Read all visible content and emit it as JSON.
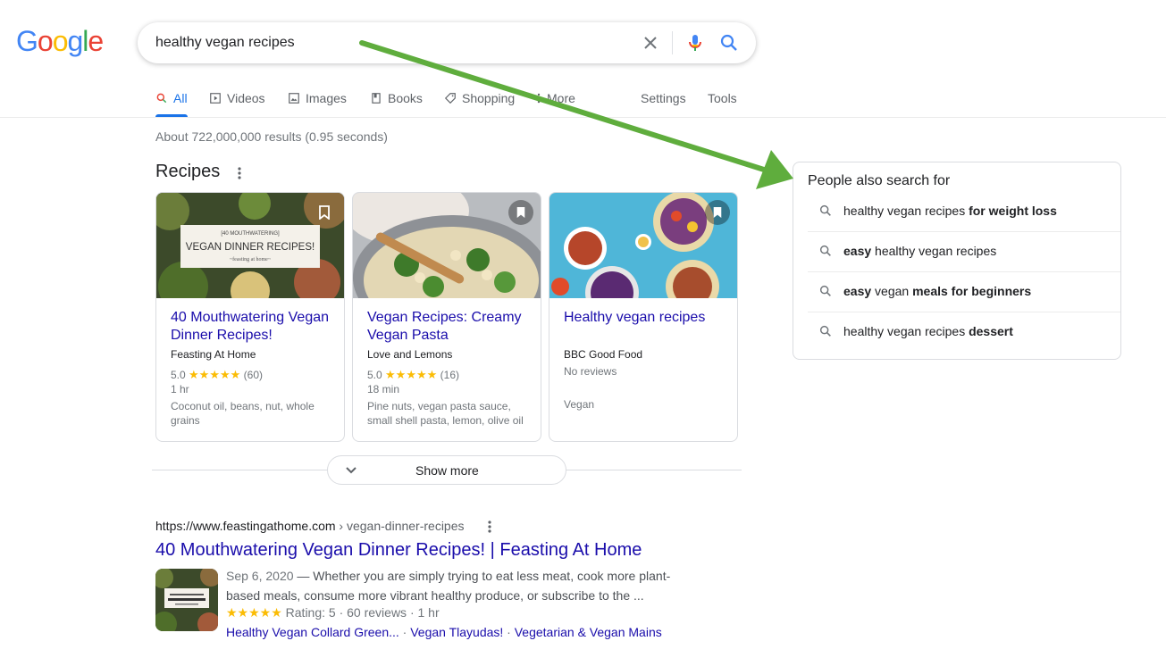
{
  "logo": {
    "letters": [
      "G",
      "o",
      "o",
      "g",
      "l",
      "e"
    ],
    "colors": [
      "#4285f4",
      "#ea4335",
      "#fbbc05",
      "#4285f4",
      "#34a853",
      "#ea4335"
    ]
  },
  "search": {
    "query": "healthy vegan recipes"
  },
  "tabs": [
    {
      "label": "All",
      "icon": "search-icon",
      "active": true
    },
    {
      "label": "Videos",
      "icon": "video-icon"
    },
    {
      "label": "Images",
      "icon": "image-icon"
    },
    {
      "label": "Books",
      "icon": "book-icon"
    },
    {
      "label": "Shopping",
      "icon": "tag-icon"
    },
    {
      "label": "More",
      "icon": "more-vert-icon"
    }
  ],
  "tools": {
    "settings": "Settings",
    "tools": "Tools"
  },
  "result_stats": "About 722,000,000 results (0.95 seconds)",
  "recipes": {
    "title": "Recipes",
    "cards": [
      {
        "title": "40 Mouthwatering Vegan Dinner Recipes!",
        "source": "Feasting At Home",
        "rating": "5.0",
        "stars": "★★★★★",
        "count": "(60)",
        "time": "1 hr",
        "ingredients": "Coconut oil, beans, nut, whole grains",
        "image_text": {
          "top": "[40 MOUTHWATERING]",
          "main": "VEGAN DINNER RECIPES!",
          "sub": "~feasting at home~"
        }
      },
      {
        "title": "Vegan Recipes: Creamy Vegan Pasta",
        "source": "Love and Lemons",
        "rating": "5.0",
        "stars": "★★★★★",
        "count": "(16)",
        "time": "18 min",
        "ingredients": "Pine nuts, vegan pasta sauce, small shell pasta, lemon, olive oil"
      },
      {
        "title": "Healthy vegan recipes",
        "source": "BBC Good Food",
        "no_reviews": "No reviews",
        "tag": "Vegan"
      }
    ],
    "show_more": "Show more"
  },
  "result": {
    "url": "https://www.feastingathome.com",
    "crumb": " › vegan-dinner-recipes",
    "title": "40 Mouthwatering Vegan Dinner Recipes! | Feasting At Home",
    "date": "Sep 6, 2020",
    "dash": " — ",
    "snippet_line1": "Whether you are simply trying to eat less meat, cook more plant-",
    "snippet_line2": "based meals, consume more vibrant healthy produce, or subscribe to the ...",
    "stars": "★★★★★",
    "rating_text": " Rating: 5 · 60 reviews · 1 hr",
    "sitelinks": [
      "Healthy Vegan Collard Green...",
      "Vegan Tlayudas!",
      "Vegetarian & Vegan Mains"
    ],
    "sep": " · "
  },
  "pasf": {
    "title": "People also search for",
    "items": [
      {
        "plain1": "healthy vegan recipes ",
        "bold1": "for weight loss",
        "plain2": "",
        "bold2": ""
      },
      {
        "plain1": "",
        "bold1": "easy",
        "plain2": " healthy vegan recipes",
        "bold2": ""
      },
      {
        "plain1": "",
        "bold1": "easy",
        "plain2": " vegan ",
        "bold2": "meals for beginners"
      },
      {
        "plain1": "healthy vegan recipes ",
        "bold1": "dessert",
        "plain2": "",
        "bold2": ""
      }
    ]
  },
  "colors": {
    "link": "#1a0dab",
    "accent": "#1a73e8",
    "star": "#fbbc04",
    "arrow": "#5fad3d"
  }
}
